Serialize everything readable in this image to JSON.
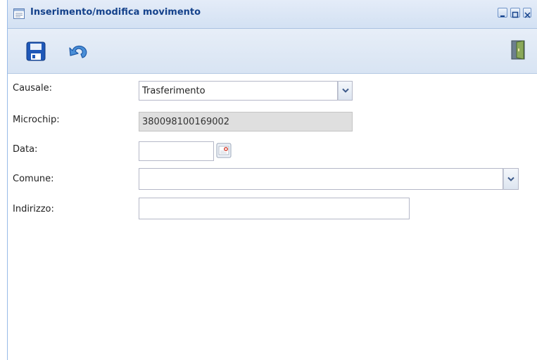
{
  "window": {
    "title": "Inserimento/modifica movimento"
  },
  "toolbar": {
    "save": "save-icon",
    "undo": "undo-icon",
    "exit": "exit-door-icon"
  },
  "form": {
    "causale": {
      "label": "Causale:",
      "value": "Trasferimento"
    },
    "microchip": {
      "label": "Microchip:",
      "value": "380098100169002"
    },
    "data": {
      "label": "Data:",
      "value": ""
    },
    "comune": {
      "label": "Comune:",
      "value": ""
    },
    "indirizzo": {
      "label": "Indirizzo:",
      "value": ""
    }
  },
  "colors": {
    "title_text": "#15428b",
    "window_border": "#99bbe8",
    "readonly_field": "#dfdfdf"
  }
}
